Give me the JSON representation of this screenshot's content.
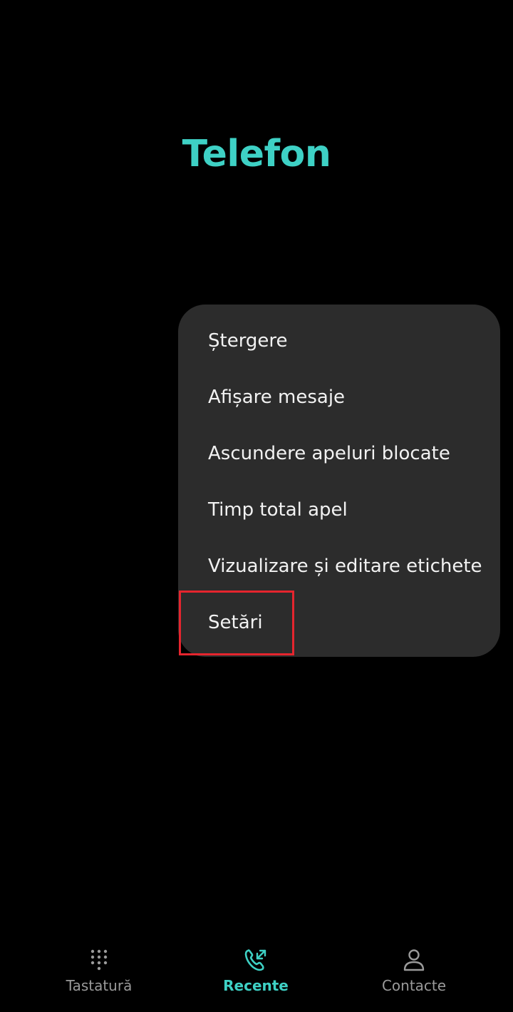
{
  "app": {
    "title": "Telefon"
  },
  "colors": {
    "accent": "#3ed1c5",
    "background": "#000000",
    "menu_background": "#2c2c2c",
    "highlight": "#e5252e",
    "inactive_label": "#9a9a9a"
  },
  "menu": {
    "items": [
      {
        "label": "Ștergere"
      },
      {
        "label": "Afișare mesaje"
      },
      {
        "label": "Ascundere apeluri blocate"
      },
      {
        "label": "Timp total apel"
      },
      {
        "label": "Vizualizare și editare etichete"
      },
      {
        "label": "Setări"
      }
    ],
    "highlighted_item": "Setări"
  },
  "bottom_nav": {
    "tabs": [
      {
        "label": "Tastatură",
        "icon": "dialpad-icon",
        "active": false
      },
      {
        "label": "Recente",
        "icon": "recent-calls-icon",
        "active": true
      },
      {
        "label": "Contacte",
        "icon": "person-icon",
        "active": false
      }
    ]
  }
}
